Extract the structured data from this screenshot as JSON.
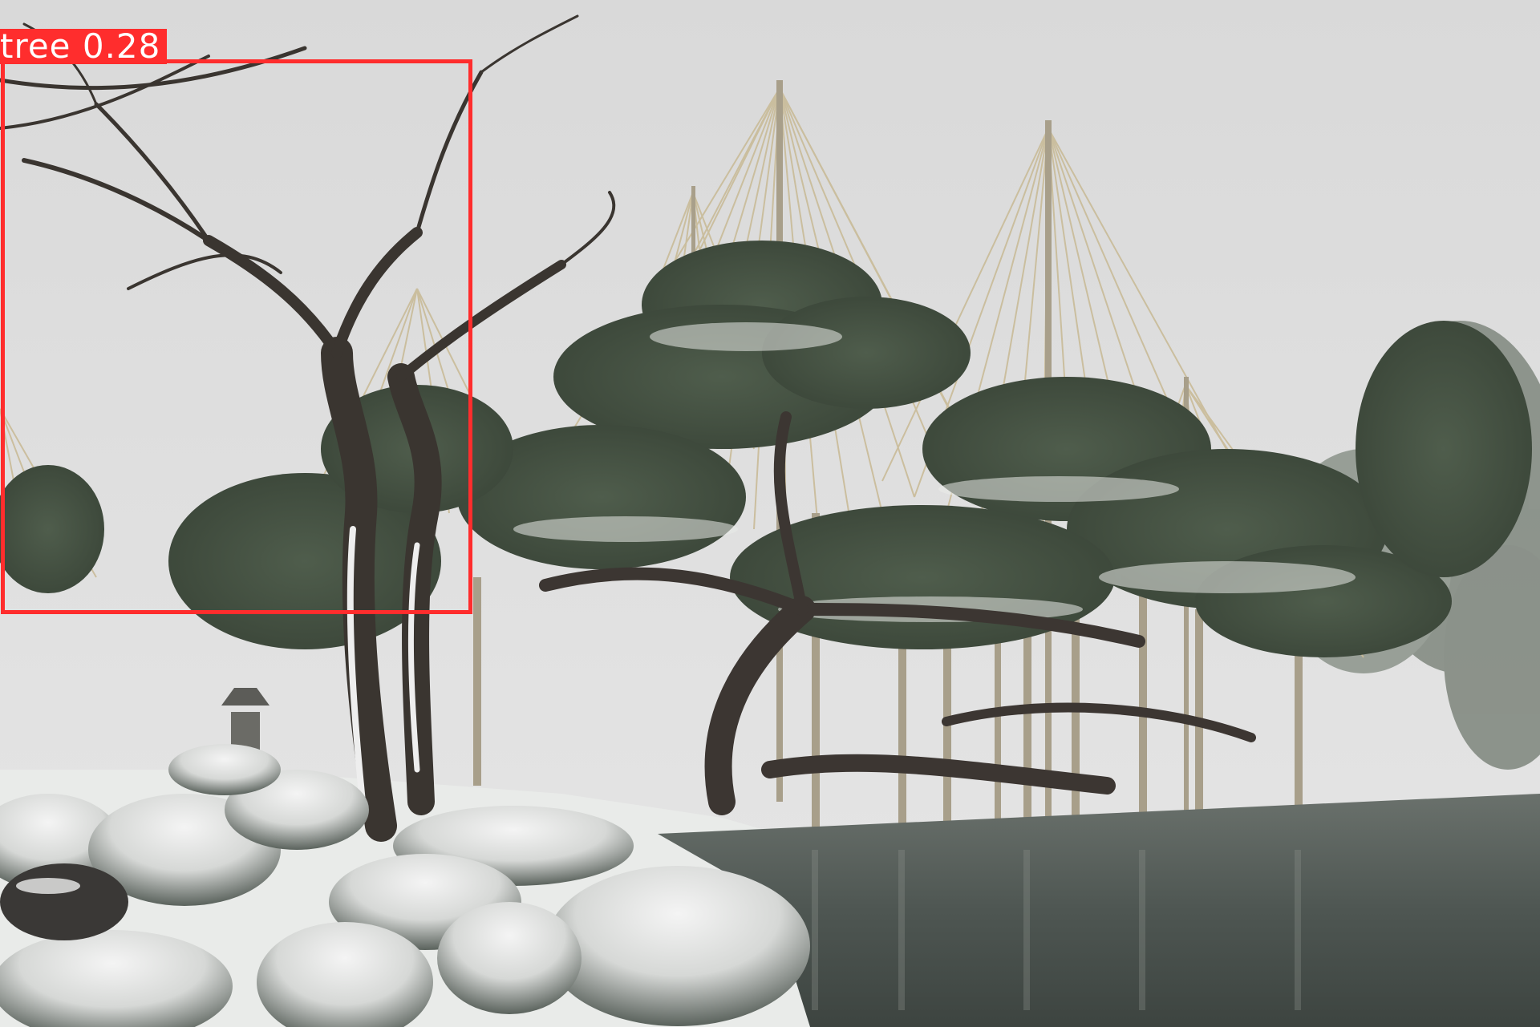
{
  "detections": [
    {
      "label": "tree 0.28",
      "class": "tree",
      "confidence": 0.28,
      "box_color": "#ff2d2d"
    }
  ]
}
